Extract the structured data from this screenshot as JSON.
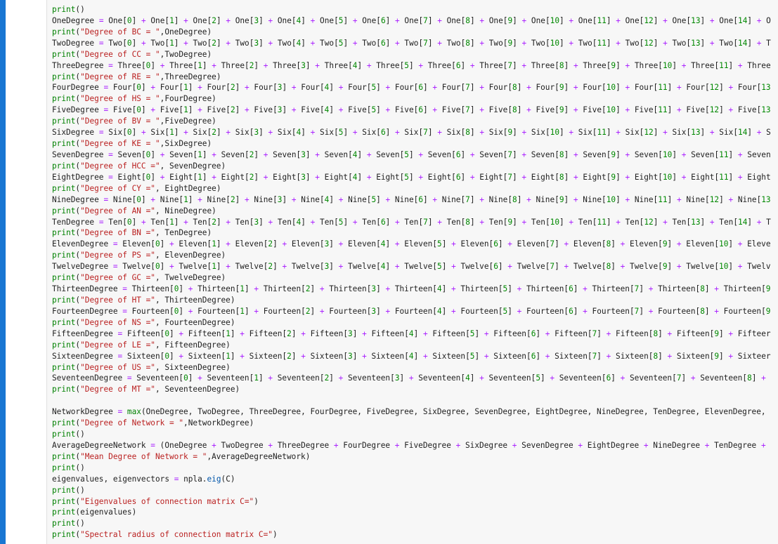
{
  "colors": {
    "cell_bar": "#1976d2",
    "editor_background": "#f7f7f7",
    "text": "#212121",
    "operator": "#aa22ff",
    "number": "#008800",
    "string": "#ba2121",
    "builtin": "#008000"
  },
  "code_lines": [
    "print()",
    "OneDegree = One[0] + One[1] + One[2] + One[3] + One[4] + One[5] + One[6] + One[7] + One[8] + One[9] + One[10] + One[11] + One[12] + One[13] + One[14] + O",
    "print(\"Degree of BC = \",OneDegree)",
    "TwoDegree = Two[0] + Two[1] + Two[2] + Two[3] + Two[4] + Two[5] + Two[6] + Two[7] + Two[8] + Two[9] + Two[10] + Two[11] + Two[12] + Two[13] + Two[14] + T",
    "print(\"Degree of CC = \",TwoDegree)",
    "ThreeDegree = Three[0] + Three[1] + Three[2] + Three[3] + Three[4] + Three[5] + Three[6] + Three[7] + Three[8] + Three[9] + Three[10] + Three[11] + Three",
    "print(\"Degree of RE = \",ThreeDegree)",
    "FourDegree = Four[0] + Four[1] + Four[2] + Four[3] + Four[4] + Four[5] + Four[6] + Four[7] + Four[8] + Four[9] + Four[10] + Four[11] + Four[12] + Four[13",
    "print(\"Degree of HS = \",FourDegree)",
    "FiveDegree = Five[0] + Five[1] + Five[2] + Five[3] + Five[4] + Five[5] + Five[6] + Five[7] + Five[8] + Five[9] + Five[10] + Five[11] + Five[12] + Five[13",
    "print(\"Degree of BV = \",FiveDegree)",
    "SixDegree = Six[0] + Six[1] + Six[2] + Six[3] + Six[4] + Six[5] + Six[6] + Six[7] + Six[8] + Six[9] + Six[10] + Six[11] + Six[12] + Six[13] + Six[14] + S",
    "print(\"Degree of KE = \",SixDegree)",
    "SevenDegree = Seven[0] + Seven[1] + Seven[2] + Seven[3] + Seven[4] + Seven[5] + Seven[6] + Seven[7] + Seven[8] + Seven[9] + Seven[10] + Seven[11] + Seven",
    "print(\"Degree of HCC =\", SevenDegree)",
    "EightDegree = Eight[0] + Eight[1] + Eight[2] + Eight[3] + Eight[4] + Eight[5] + Eight[6] + Eight[7] + Eight[8] + Eight[9] + Eight[10] + Eight[11] + Eight",
    "print(\"Degree of CY =\", EightDegree)",
    "NineDegree = Nine[0] + Nine[1] + Nine[2] + Nine[3] + Nine[4] + Nine[5] + Nine[6] + Nine[7] + Nine[8] + Nine[9] + Nine[10] + Nine[11] + Nine[12] + Nine[13",
    "print(\"Degree of AN =\", NineDegree)",
    "TenDegree = Ten[0] + Ten[1] + Ten[2] + Ten[3] + Ten[4] + Ten[5] + Ten[6] + Ten[7] + Ten[8] + Ten[9] + Ten[10] + Ten[11] + Ten[12] + Ten[13] + Ten[14] + T",
    "print(\"Degree of BN =\", TenDegree)",
    "ElevenDegree = Eleven[0] + Eleven[1] + Eleven[2] + Eleven[3] + Eleven[4] + Eleven[5] + Eleven[6] + Eleven[7] + Eleven[8] + Eleven[9] + Eleven[10] + Eleve",
    "print(\"Degree of PS =\", ElevenDegree)",
    "TwelveDegree = Twelve[0] + Twelve[1] + Twelve[2] + Twelve[3] + Twelve[4] + Twelve[5] + Twelve[6] + Twelve[7] + Twelve[8] + Twelve[9] + Twelve[10] + Twelv",
    "print(\"Degree of GC =\", TwelveDegree)",
    "ThirteenDegree = Thirteen[0] + Thirteen[1] + Thirteen[2] + Thirteen[3] + Thirteen[4] + Thirteen[5] + Thirteen[6] + Thirteen[7] + Thirteen[8] + Thirteen[9",
    "print(\"Degree of HT =\", ThirteenDegree)",
    "FourteenDegree = Fourteen[0] + Fourteen[1] + Fourteen[2] + Fourteen[3] + Fourteen[4] + Fourteen[5] + Fourteen[6] + Fourteen[7] + Fourteen[8] + Fourteen[9",
    "print(\"Degree of NS =\", FourteenDegree)",
    "FifteenDegree = Fifteen[0] + Fifteen[1] + Fifteen[2] + Fifteen[3] + Fifteen[4] + Fifteen[5] + Fifteen[6] + Fifteen[7] + Fifteen[8] + Fifteen[9] + Fifteer",
    "print(\"Degree of LE =\", FifteenDegree)",
    "SixteenDegree = Sixteen[0] + Sixteen[1] + Sixteen[2] + Sixteen[3] + Sixteen[4] + Sixteen[5] + Sixteen[6] + Sixteen[7] + Sixteen[8] + Sixteen[9] + Sixteer",
    "print(\"Degree of US =\", SixteenDegree)",
    "SeventeenDegree = Seventeen[0] + Seventeen[1] + Seventeen[2] + Seventeen[3] + Seventeen[4] + Seventeen[5] + Seventeen[6] + Seventeen[7] + Seventeen[8] +",
    "print(\"Degree of MT =\", SeventeenDegree)",
    "",
    "NetworkDegree = max(OneDegree, TwoDegree, ThreeDegree, FourDegree, FiveDegree, SixDegree, SevenDegree, EightDegree, NineDegree, TenDegree, ElevenDegree,",
    "print(\"Degree of Network = \",NetworkDegree)",
    "print()",
    "AverageDegreeNetwork = (OneDegree + TwoDegree + ThreeDegree + FourDegree + FiveDegree + SixDegree + SevenDegree + EightDegree + NineDegree + TenDegree +",
    "print(\"Mean Degree of Network = \",AverageDegreeNetwork)",
    "print()",
    "eigenvalues, eigenvectors = npla.eig(C)",
    "print()",
    "print(\"Eigenvalues of connection matrix C=\")",
    "print(eigenvalues)",
    "print()",
    "print(\"Spectral radius of connection matrix C=\")"
  ]
}
